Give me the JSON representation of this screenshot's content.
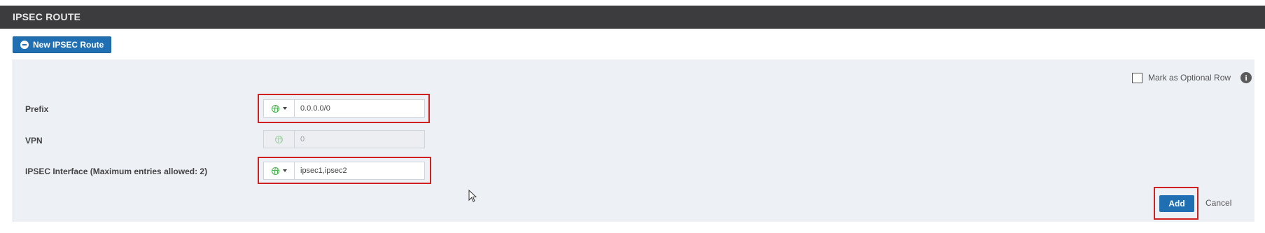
{
  "header": {
    "title": "IPSEC ROUTE"
  },
  "toolbar": {
    "new_route_label": "New IPSEC Route",
    "new_route_icon": "plus-circle-icon"
  },
  "optional_row": {
    "label": "Mark as Optional Row",
    "checked": false,
    "info_icon": "info-icon"
  },
  "fields": {
    "prefix": {
      "label": "Prefix",
      "value": "0.0.0.0/0",
      "scope_icon": "globe-icon"
    },
    "vpn": {
      "label": "VPN",
      "value": "0",
      "disabled": true,
      "scope_icon": "globe-icon"
    },
    "ipsec_interface": {
      "label": "IPSEC Interface (Maximum entries allowed: 2)",
      "value": "ipsec1,ipsec2",
      "scope_icon": "globe-icon"
    }
  },
  "actions": {
    "add_label": "Add",
    "cancel_label": "Cancel"
  },
  "colors": {
    "header_bg": "#3c3c3e",
    "primary": "#1f6fb2",
    "panel_bg": "#edf0f5",
    "highlight": "#d0201f",
    "globe": "#49b04d"
  }
}
